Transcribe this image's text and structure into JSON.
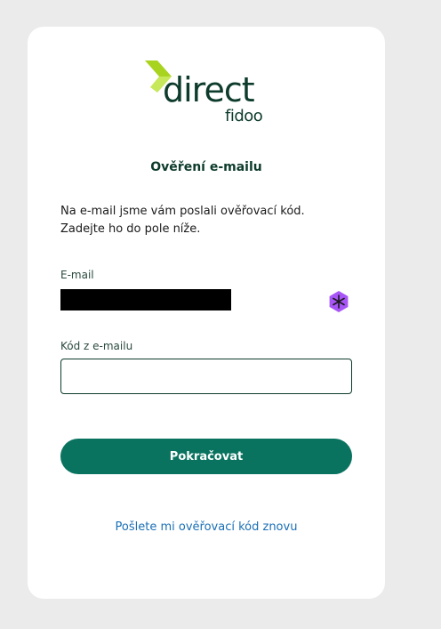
{
  "logo": {
    "word": "direct",
    "sub": "fidoo"
  },
  "title": "Ověření e-mailu",
  "intro": {
    "line1": "Na e-mail jsme vám poslali ověřovací kód.",
    "line2": "Zadejte ho do pole níže."
  },
  "email": {
    "label": "E-mail",
    "value": ""
  },
  "code": {
    "label": "Kód z e-mailu",
    "value": "",
    "placeholder": ""
  },
  "submit_label": "Pokračovat",
  "resend_label": "Pošlete mi ověřovací kód znovu",
  "colors": {
    "brand_dark": "#0d3b2c",
    "brand_lime": "#a8d420",
    "button": "#0a7360",
    "link": "#1a6fb5",
    "extension_icon": "#a855f7"
  },
  "icons": {
    "logo_mark": "chevron-arrow-icon",
    "extension": "snowflake-extension-icon"
  }
}
